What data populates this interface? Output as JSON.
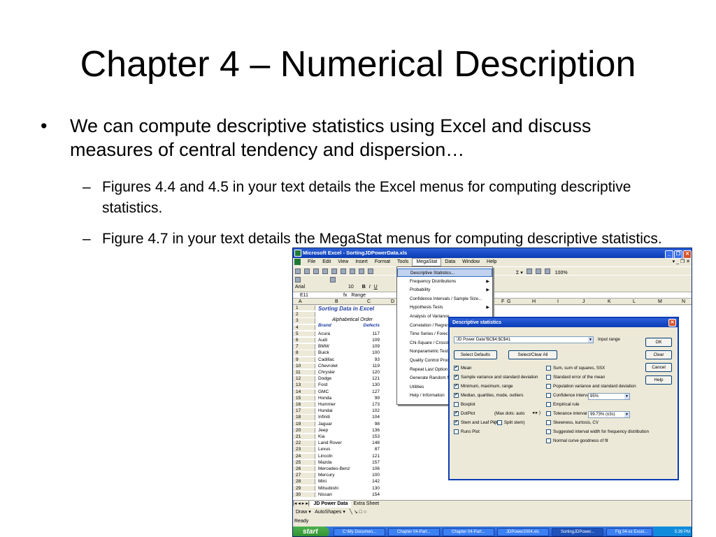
{
  "slide": {
    "title": "Chapter 4 – Numerical Description",
    "bullet": "We can compute descriptive statistics using Excel and discuss measures of central tendency and dispersion…",
    "sub1": "Figures 4.4 and 4.5 in your text details the Excel menus for computing descriptive statistics.",
    "sub2": "Figure 4.7 in your text details the MegaStat menus for computing descriptive statistics."
  },
  "excel": {
    "title": "Microsoft Excel - SortingJDPowerData.xls",
    "menu": [
      "File",
      "Edit",
      "View",
      "Insert",
      "Format",
      "Tools",
      "MegaStat",
      "Data",
      "Window",
      "Help"
    ],
    "font_name": "Arial",
    "font_size": "10",
    "zoom": "100%",
    "name_box": "E11",
    "formula": "Range",
    "columns": [
      "A",
      "B",
      "C",
      "D",
      "E",
      "F",
      "G",
      "H",
      "I",
      "J",
      "K",
      "L",
      "M",
      "N"
    ],
    "sheet_title": "Sorting Data in Excel",
    "order_label": "Alphabetical Order",
    "brand_header": "Brand",
    "defects_header": "Defects",
    "rows": [
      [
        "Acura",
        "117"
      ],
      [
        "Audi",
        "109"
      ],
      [
        "BMW",
        "109"
      ],
      [
        "Buick",
        "100"
      ],
      [
        "Cadillac",
        "93"
      ],
      [
        "Chevrolet",
        "119"
      ],
      [
        "Chrysler",
        "120"
      ],
      [
        "Dodge",
        "121"
      ],
      [
        "Ford",
        "130"
      ],
      [
        "GMC",
        "127"
      ],
      [
        "Honda",
        "99"
      ],
      [
        "Hummer",
        "173"
      ],
      [
        "Hundai",
        "102"
      ],
      [
        "Infiniti",
        "104"
      ],
      [
        "Jaguar",
        "98"
      ],
      [
        "Jeep",
        "136"
      ],
      [
        "Kia",
        "153"
      ],
      [
        "Land Rover",
        "148"
      ],
      [
        "Lexus",
        "87"
      ],
      [
        "Lincoln",
        "121"
      ],
      [
        "Mazda",
        "157"
      ],
      [
        "Mercedes-Benz",
        "106"
      ],
      [
        "Mercury",
        "100"
      ],
      [
        "Mini",
        "142"
      ],
      [
        "Mitsubishi",
        "130"
      ],
      [
        "Nissan",
        "154"
      ]
    ],
    "row_numbers": [
      "1",
      "2",
      "3",
      "4",
      "5",
      "6",
      "7",
      "8",
      "9",
      "10",
      "11",
      "12",
      "13",
      "14",
      "15",
      "16",
      "17",
      "18",
      "19",
      "20",
      "21",
      "22",
      "23",
      "24",
      "25",
      "26",
      "27",
      "28",
      "29",
      "30"
    ],
    "tabs": [
      "JD Power Data",
      "Extra Sheet"
    ],
    "draw_label": "Draw",
    "autoshapes_label": "AutoShapes",
    "status": "Ready",
    "megastat_menu": [
      "Descriptive Statistics...",
      "Frequency Distributions",
      "Probability",
      "Confidence Intervals / Sample Size...",
      "Hypothesis Tests",
      "Analysis of Variance",
      "Correlation / Regression",
      "Time Series / Forecasting",
      "Chi-Square / Crosstab",
      "Nonparametric Tests",
      "Quality Control Process Charts",
      "Repeat Last Option",
      "Generate Random Numbers",
      "Utilities",
      "Help / Information"
    ],
    "dialog": {
      "title": "Descriptive statistics",
      "input_value": "'JD Power Data'!$C$4:$C$41",
      "input_label": "Input range",
      "ok": "OK",
      "clear": "Clear",
      "cancel": "Cancel",
      "help": "Help",
      "select_defaults": "Select Defaults",
      "select_clear_all": "Select/Clear All",
      "left_options": [
        "Mean",
        "Sample variance and standard deviation",
        "Minimum, maximum, range",
        "Median, quartiles, mode, outliers",
        "Boxplot",
        "DotPlot",
        "Stem and Leaf Plot",
        "Runs Plot"
      ],
      "dotplot_extra": "(Max dots: auto",
      "split_stem": "Split stem)",
      "right_options": [
        "Sum, sum of squares, SSX",
        "Standard error of the mean",
        "Population variance and standard deviation",
        "Confidence interval",
        "Empirical rule",
        "Tolerance interval",
        "Skewness, kurtosis, CV",
        "Suggested interval width for frequency distribution",
        "Normal curve goodness of fit"
      ],
      "ci_value": "95%",
      "tol_value": "99.73% (±3s)"
    },
    "taskbar": {
      "start": "start",
      "tasks": [
        "C:\\My Documen...",
        "Chapter 04-Part...",
        "Chapter 04-Part...",
        "JDPower2004.xls",
        "SortingJDPower...",
        "Fig 04-xx Excel..."
      ],
      "clock": "5:39 PM"
    }
  }
}
